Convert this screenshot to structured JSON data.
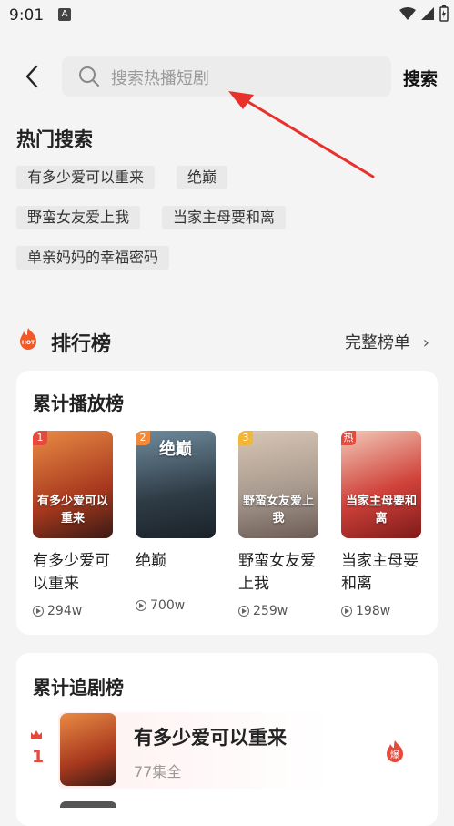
{
  "status": {
    "time": "9:01",
    "icon_a": "A"
  },
  "header": {
    "search_placeholder": "搜索热播短剧",
    "search_button": "搜索"
  },
  "hot_search": {
    "title": "热门搜索",
    "tags": [
      "有多少爱可以重来",
      "绝巅",
      "野蛮女友爱上我",
      "当家主母要和离",
      "单亲妈妈的幸福密码"
    ]
  },
  "ranking": {
    "title": "排行榜",
    "hot_icon": "HOT",
    "full_list": "完整榜单",
    "play_board": {
      "title": "累计播放榜",
      "items": [
        {
          "badge": "1",
          "badge_color": "#e64a3c",
          "name": "有多少爱可以重来",
          "plays": "294w",
          "poster_text": "有多少爱可以重来"
        },
        {
          "badge": "2",
          "badge_color": "#f08a3c",
          "name": "绝巅",
          "plays": "700w",
          "poster_text": "绝巅"
        },
        {
          "badge": "3",
          "badge_color": "#f1b63a",
          "name": "野蛮女友爱上我",
          "plays": "259w",
          "poster_text": "野蛮女友爱上我"
        },
        {
          "badge": "热",
          "badge_color": "#e64a3c",
          "name": "当家主母要和离",
          "plays": "198w",
          "poster_text": "当家主母要和离"
        }
      ]
    },
    "follow_board": {
      "title": "累计追剧榜",
      "items": [
        {
          "rank": "1",
          "name": "有多少爱可以重来",
          "episodes": "77集全",
          "fire": "爆"
        }
      ]
    }
  }
}
